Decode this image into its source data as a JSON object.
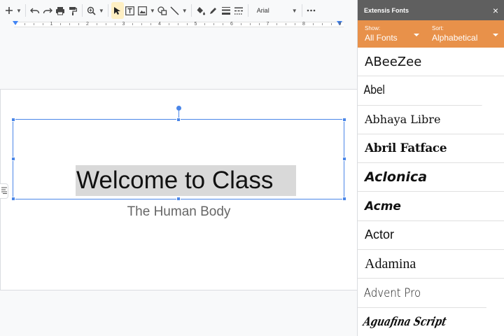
{
  "toolbar": {
    "font_name": "Arial",
    "icons": [
      "plus-icon",
      "undo-icon",
      "redo-icon",
      "print-icon",
      "paint-format-icon",
      "zoom-icon",
      "select-cursor-icon",
      "textbox-icon",
      "image-icon",
      "shape-icon",
      "line-icon",
      "fill-color-icon",
      "border-color-icon",
      "border-weight-icon",
      "border-dash-icon",
      "more-icon"
    ]
  },
  "ruler": {
    "numbers": [
      "1",
      "2",
      "3",
      "4",
      "5",
      "6",
      "7",
      "8",
      "9"
    ]
  },
  "slide": {
    "title": "Welcome to Class",
    "subtitle": "The Human Body"
  },
  "sidebar": {
    "title": "Extensis Fonts",
    "close_symbol": "×",
    "show_label": "Show:",
    "show_value": "All Fonts",
    "sort_label": "Sort:",
    "sort_value": "Alphabetical",
    "fonts": [
      "ABeeZee",
      "Abel",
      "Abhaya Libre",
      "Abril Fatface",
      "Aclonica",
      "Acme",
      "Actor",
      "Adamina",
      "Advent Pro",
      "Aguafina Script"
    ]
  },
  "colors": {
    "sidebar_header": "#5f5f5f",
    "filter_bar": "#e8914a",
    "selection": "#4a86e8",
    "text_highlight": "#d9d9d9"
  }
}
